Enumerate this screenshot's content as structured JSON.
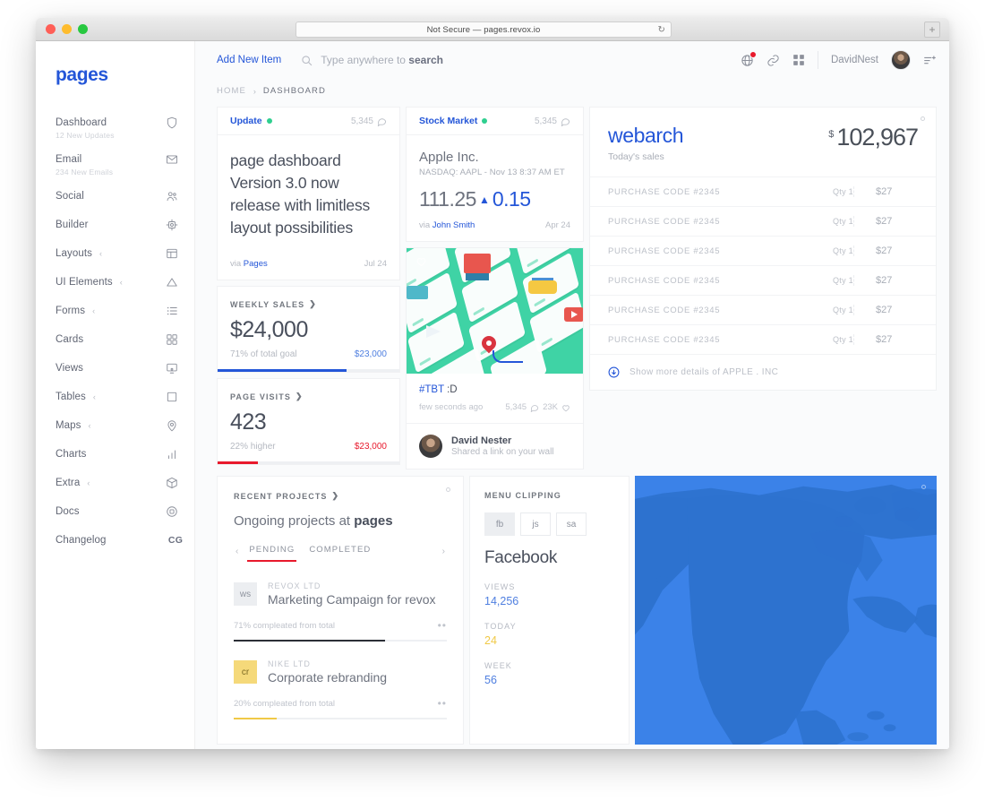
{
  "browser": {
    "url_text": "Not Secure — pages.revox.io",
    "reload_glyph": "↻",
    "newtab_glyph": "+"
  },
  "sidebar": {
    "brand": "pages",
    "items": [
      {
        "label": "Dashboard",
        "sub": "12 New Updates",
        "icon": "shield-icon",
        "caret": ""
      },
      {
        "label": "Email",
        "sub": "234 New Emails",
        "icon": "envelope-icon",
        "caret": ""
      },
      {
        "label": "Social",
        "sub": "",
        "icon": "users-icon",
        "caret": ""
      },
      {
        "label": "Builder",
        "sub": "",
        "icon": "chip-icon",
        "caret": ""
      },
      {
        "label": "Layouts",
        "sub": "",
        "icon": "layout-icon",
        "caret": "‹"
      },
      {
        "label": "UI Elements",
        "sub": "",
        "icon": "triangle-icon",
        "caret": "‹"
      },
      {
        "label": "Forms",
        "sub": "",
        "icon": "list-icon",
        "caret": "‹"
      },
      {
        "label": "Cards",
        "sub": "",
        "icon": "grid-icon",
        "caret": ""
      },
      {
        "label": "Views",
        "sub": "",
        "icon": "monitor-icon",
        "caret": ""
      },
      {
        "label": "Tables",
        "sub": "",
        "icon": "square-icon",
        "caret": "‹"
      },
      {
        "label": "Maps",
        "sub": "",
        "icon": "pin-icon",
        "caret": "‹"
      },
      {
        "label": "Charts",
        "sub": "",
        "icon": "bars-icon",
        "caret": ""
      },
      {
        "label": "Extra",
        "sub": "",
        "icon": "cube-icon",
        "caret": "‹"
      },
      {
        "label": "Docs",
        "sub": "",
        "icon": "docs-icon",
        "caret": ""
      },
      {
        "label": "Changelog",
        "sub": "",
        "icon": "cg-text",
        "caret": "",
        "icon_text": "CG"
      }
    ]
  },
  "topbar": {
    "add_new": "Add New Item",
    "search_placeholder": "Type anywhere to search",
    "search_value": "",
    "search_hint_prefix": "Type anywhere to ",
    "search_hint_bold": "search",
    "username": "DavidNest"
  },
  "breadcrumb": {
    "home": "HOME",
    "sep": "›",
    "current": "DASHBOARD"
  },
  "update_card": {
    "title": "Update",
    "comments": "5,345",
    "body": "page dashboard Version 3.0 now release with limitless layout possibilities",
    "via_prefix": "via ",
    "via_name": "Pages",
    "date": "Jul 24"
  },
  "weekly_sales": {
    "title": "WEEKLY SALES",
    "chevron": "❯",
    "value": "$24,000",
    "sub": "71% of total goal",
    "amount": "$23,000",
    "amount_color": "#4f7fe0",
    "bar_color": "#2456d8",
    "percent": 71
  },
  "page_visits": {
    "title": "PAGE VISITS",
    "chevron": "❯",
    "value": "423",
    "sub": "22% higher",
    "amount": "$23,000",
    "amount_color": "#e8192c",
    "bar_color": "#e8192c",
    "percent": 22
  },
  "stock_card": {
    "title": "Stock Market",
    "comments": "5,345",
    "company": "Apple Inc.",
    "meta": "NASDAQ: AAPL - Nov 13 8:37 AM ET",
    "price": "111.25",
    "arrow": "▲",
    "delta": "0.15",
    "via_prefix": "via ",
    "via_name": "John Smith",
    "date": "Apr 24"
  },
  "tbt": {
    "tag": "#TBT",
    "rest": " :D",
    "ago": "few seconds ago",
    "comments": "5,345",
    "likes": "23K"
  },
  "person": {
    "name": "David Nester",
    "sub": "Shared a link on your wall"
  },
  "webarch": {
    "title": "webarch",
    "subtitle": "Today's sales",
    "currency": "$",
    "amount": "102,967",
    "rows": [
      {
        "code": "PURCHASE CODE #2345",
        "qty": "Qty 1",
        "price": "$27"
      },
      {
        "code": "PURCHASE CODE #2345",
        "qty": "Qty 1",
        "price": "$27"
      },
      {
        "code": "PURCHASE CODE #2345",
        "qty": "Qty 1",
        "price": "$27"
      },
      {
        "code": "PURCHASE CODE #2345",
        "qty": "Qty 1",
        "price": "$27"
      },
      {
        "code": "PURCHASE CODE #2345",
        "qty": "Qty 1",
        "price": "$27"
      },
      {
        "code": "PURCHASE CODE #2345",
        "qty": "Qty 1",
        "price": "$27"
      }
    ],
    "show_more": "Show more details of APPLE . INC"
  },
  "recent_projects": {
    "title": "RECENT PROJECTS",
    "chevron": "❯",
    "heading_prefix": "Ongoing projects at ",
    "heading_bold": "pages",
    "arrow_left": "‹",
    "arrow_right": "›",
    "tabs": [
      {
        "label": "PENDING",
        "active": true
      },
      {
        "label": "COMPLETED",
        "active": false
      }
    ],
    "projects": [
      {
        "badge": "ws",
        "badge_color": "#eceef1",
        "company": "REVOX LTD",
        "name": "Marketing Campaign for revox",
        "progress_text": "71% compleated from total",
        "percent": 71,
        "bar_color": "#2b2f36",
        "dots": "••"
      },
      {
        "badge": "cr",
        "badge_color": "#f5d97a",
        "company": "NIKE LTD",
        "name": "Corporate rebranding",
        "progress_text": "20% compleated from total",
        "percent": 20,
        "bar_color": "#f0c947",
        "dots": "••"
      }
    ]
  },
  "menu_clipping": {
    "title": "MENU CLIPPING",
    "tabs": [
      {
        "label": "fb",
        "active": true
      },
      {
        "label": "js",
        "active": false
      },
      {
        "label": "sa",
        "active": false
      }
    ],
    "heading": "Facebook",
    "stats": [
      {
        "label": "VIEWS",
        "value": "14,256",
        "color": "#4f7fe0"
      },
      {
        "label": "TODAY",
        "value": "24",
        "color": "#f0c947"
      },
      {
        "label": "WEEK",
        "value": "56",
        "color": "#4f7fe0"
      }
    ]
  },
  "map": {
    "ocean_color": "#3b82e8",
    "land_color": "#2d72cf"
  }
}
